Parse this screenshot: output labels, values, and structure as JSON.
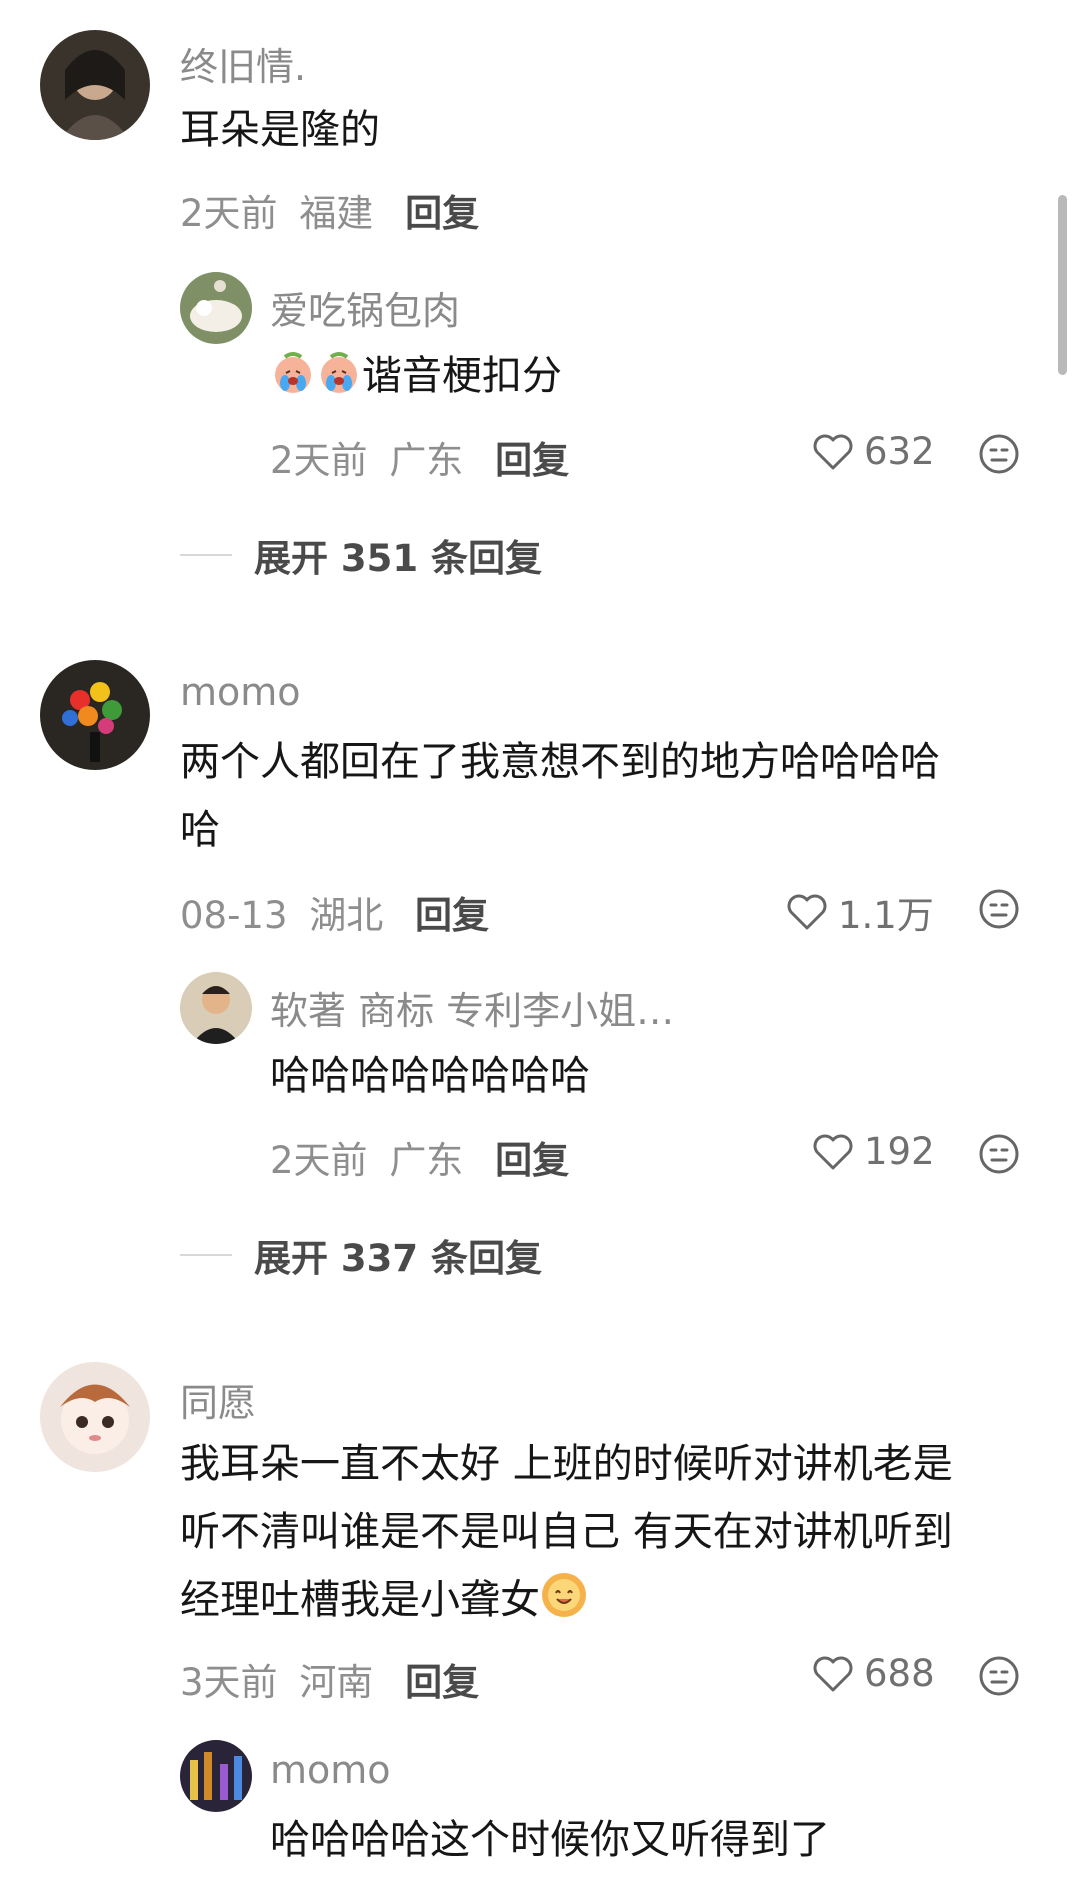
{
  "comments": [
    {
      "user": "终旧情.",
      "text": "耳朵是隆的",
      "time": "2天前",
      "location": "福建",
      "reply_label": "回复",
      "replies": [
        {
          "user": "爱吃锅包肉",
          "text": "谐音梗扣分",
          "time": "2天前",
          "location": "广东",
          "reply_label": "回复",
          "likes": "632"
        }
      ],
      "expand_label": "展开 351 条回复"
    },
    {
      "user": "momo",
      "text_line1": "两个人都回在了我意想不到的地方哈哈哈哈",
      "text_line2": "哈",
      "time": "08-13",
      "location": "湖北",
      "reply_label": "回复",
      "likes": "1.1万",
      "replies": [
        {
          "user": "软著 商标 专利李小姐…",
          "text": "哈哈哈哈哈哈哈哈",
          "time": "2天前",
          "location": "广东",
          "reply_label": "回复",
          "likes": "192"
        }
      ],
      "expand_label": "展开 337 条回复"
    },
    {
      "user": "同愿",
      "text_line1": "我耳朵一直不太好 上班的时候听对讲机老是",
      "text_line2": "听不清叫谁是不是叫自己 有天在对讲机听到",
      "text_line3": "经理吐槽我是小聋女",
      "time": "3天前",
      "location": "河南",
      "reply_label": "回复",
      "likes": "688",
      "replies": [
        {
          "user": "momo",
          "text": "哈哈哈哈这个时候你又听得到了"
        }
      ]
    }
  ]
}
